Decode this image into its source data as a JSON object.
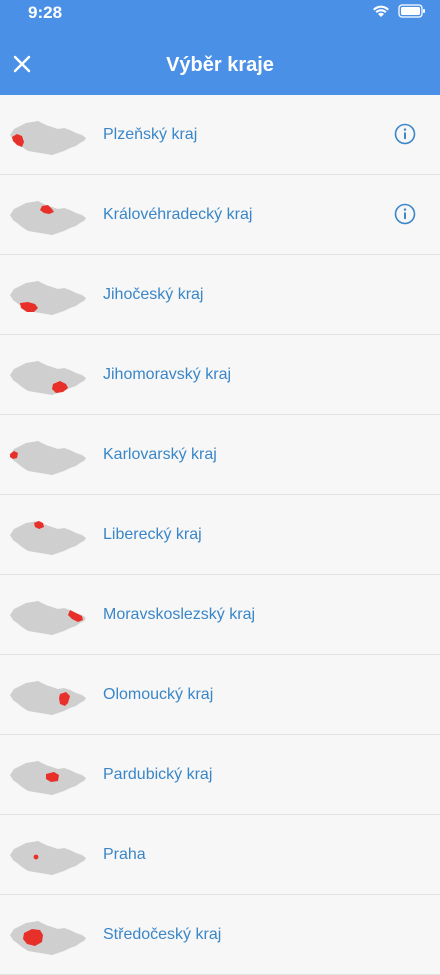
{
  "status_bar": {
    "time": "9:28"
  },
  "header": {
    "title": "Výběr kraje"
  },
  "regions": [
    {
      "label": "Plzeňský kraj",
      "info": true
    },
    {
      "label": "Královéhradecký kraj",
      "info": true
    },
    {
      "label": "Jihočeský kraj",
      "info": false
    },
    {
      "label": "Jihomoravský kraj",
      "info": false
    },
    {
      "label": "Karlovarský kraj",
      "info": false
    },
    {
      "label": "Liberecký kraj",
      "info": false
    },
    {
      "label": "Moravskoslezský kraj",
      "info": false
    },
    {
      "label": "Olomoucký kraj",
      "info": false
    },
    {
      "label": "Pardubický kraj",
      "info": false
    },
    {
      "label": "Praha",
      "info": false
    },
    {
      "label": "Středočeský kraj",
      "info": false
    }
  ],
  "colors": {
    "header": "#4a90e6",
    "label": "#3a86c8",
    "map_base": "#cfcfcf",
    "map_highlight": "#e8302b"
  }
}
